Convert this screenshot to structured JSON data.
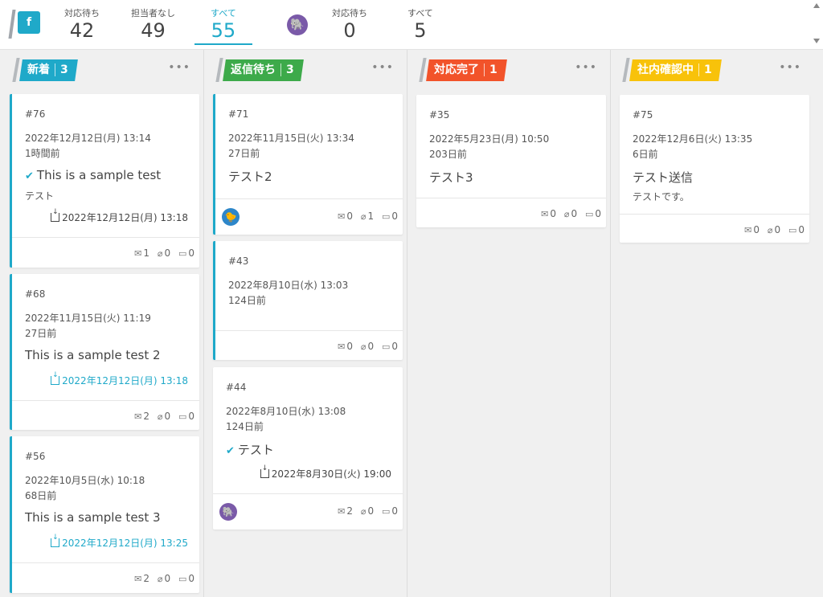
{
  "topbar": {
    "brand_letter": "f",
    "stats_brand": [
      {
        "label": "対応待ち",
        "value": "42"
      },
      {
        "label": "担当者なし",
        "value": "49"
      },
      {
        "label": "すべて",
        "value": "55"
      }
    ],
    "stats_user": [
      {
        "label": "対応待ち",
        "value": "0"
      },
      {
        "label": "すべて",
        "value": "5"
      }
    ]
  },
  "colors": {
    "accent": "#1fa9c9",
    "new": "#1fa9c9",
    "waiting": "#3daa4a",
    "done": "#f2532a",
    "internal": "#f8c20a"
  },
  "columns": [
    {
      "title": "新着",
      "count": "3",
      "cards": [
        {
          "id": "#76",
          "date": "2022年12月12日(月) 13:14",
          "ago": "1時間前",
          "title": "This is a sample test",
          "checked": true,
          "sub": "テスト",
          "due": "2022年12月12日(月) 13:18",
          "mail": "1",
          "clip": "0",
          "note": "0"
        },
        {
          "id": "#68",
          "date": "2022年11月15日(火) 11:19",
          "ago": "27日前",
          "title": "This is a sample test 2",
          "checked": false,
          "due": "2022年12月12日(月) 13:18",
          "mail": "2",
          "clip": "0",
          "note": "0"
        },
        {
          "id": "#56",
          "date": "2022年10月5日(水) 10:18",
          "ago": "68日前",
          "title": "This is a sample test 3",
          "checked": false,
          "due": "2022年12月12日(月) 13:25",
          "mail": "2",
          "clip": "0",
          "note": "0"
        }
      ]
    },
    {
      "title": "返信待ち",
      "count": "3",
      "cards": [
        {
          "id": "#71",
          "date": "2022年11月15日(火) 13:34",
          "ago": "27日前",
          "title": "テスト2",
          "avatar": "duck-icon",
          "mail": "0",
          "clip": "1",
          "note": "0"
        },
        {
          "id": "#43",
          "date": "2022年8月10日(水) 13:03",
          "ago": "124日前",
          "mail": "0",
          "clip": "0",
          "note": "0"
        },
        {
          "id": "#44",
          "date": "2022年8月10日(水) 13:08",
          "ago": "124日前",
          "title": "テスト",
          "checked": true,
          "due": "2022年8月30日(火) 19:00",
          "avatar": "elephant-icon",
          "mail": "2",
          "clip": "0",
          "note": "0"
        }
      ]
    },
    {
      "title": "対応完了",
      "count": "1",
      "cards": [
        {
          "id": "#35",
          "date": "2022年5月23日(月) 10:50",
          "ago": "203日前",
          "title": "テスト3",
          "mail": "0",
          "clip": "0",
          "note": "0"
        }
      ]
    },
    {
      "title": "社内確認中",
      "count": "1",
      "cards": [
        {
          "id": "#75",
          "date": "2022年12月6日(火) 13:35",
          "ago": "6日前",
          "title": "テスト送信",
          "sub": "テストです。",
          "mail": "0",
          "clip": "0",
          "note": "0"
        }
      ]
    }
  ],
  "more_icon": "•••",
  "icons": {
    "check": "✔",
    "mail": "✉",
    "clip": "⌀",
    "note": "▭",
    "elephant": "🐘",
    "duck": "🐤"
  }
}
